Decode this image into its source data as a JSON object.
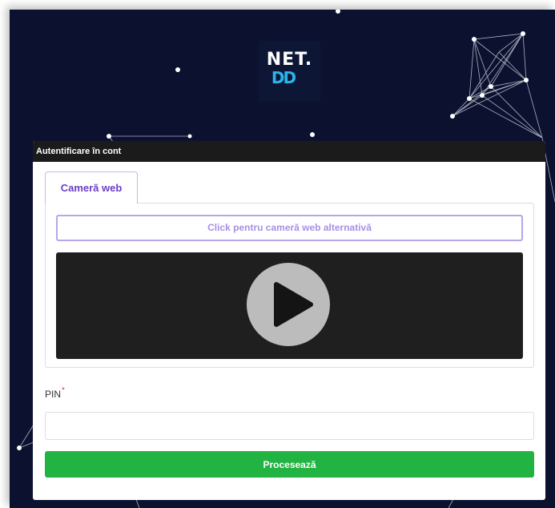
{
  "logo": {
    "line1": "NET.",
    "line2": "DD"
  },
  "dialog": {
    "title": "Autentificare în cont"
  },
  "tabs": [
    {
      "label": "Cameră web",
      "active": true
    }
  ],
  "webcam": {
    "alternate_button": "Click pentru cameră web alternativă",
    "play_icon": "play-icon"
  },
  "pin": {
    "label": "PIN",
    "required_marker": "*",
    "value": "",
    "placeholder": ""
  },
  "submit": {
    "label": "Procesează"
  },
  "colors": {
    "background": "#0c1130",
    "accent_purple": "#6c3fc7",
    "submit_green": "#22b443",
    "required_red": "#e0333a",
    "header_dark": "#1b1b1b"
  }
}
